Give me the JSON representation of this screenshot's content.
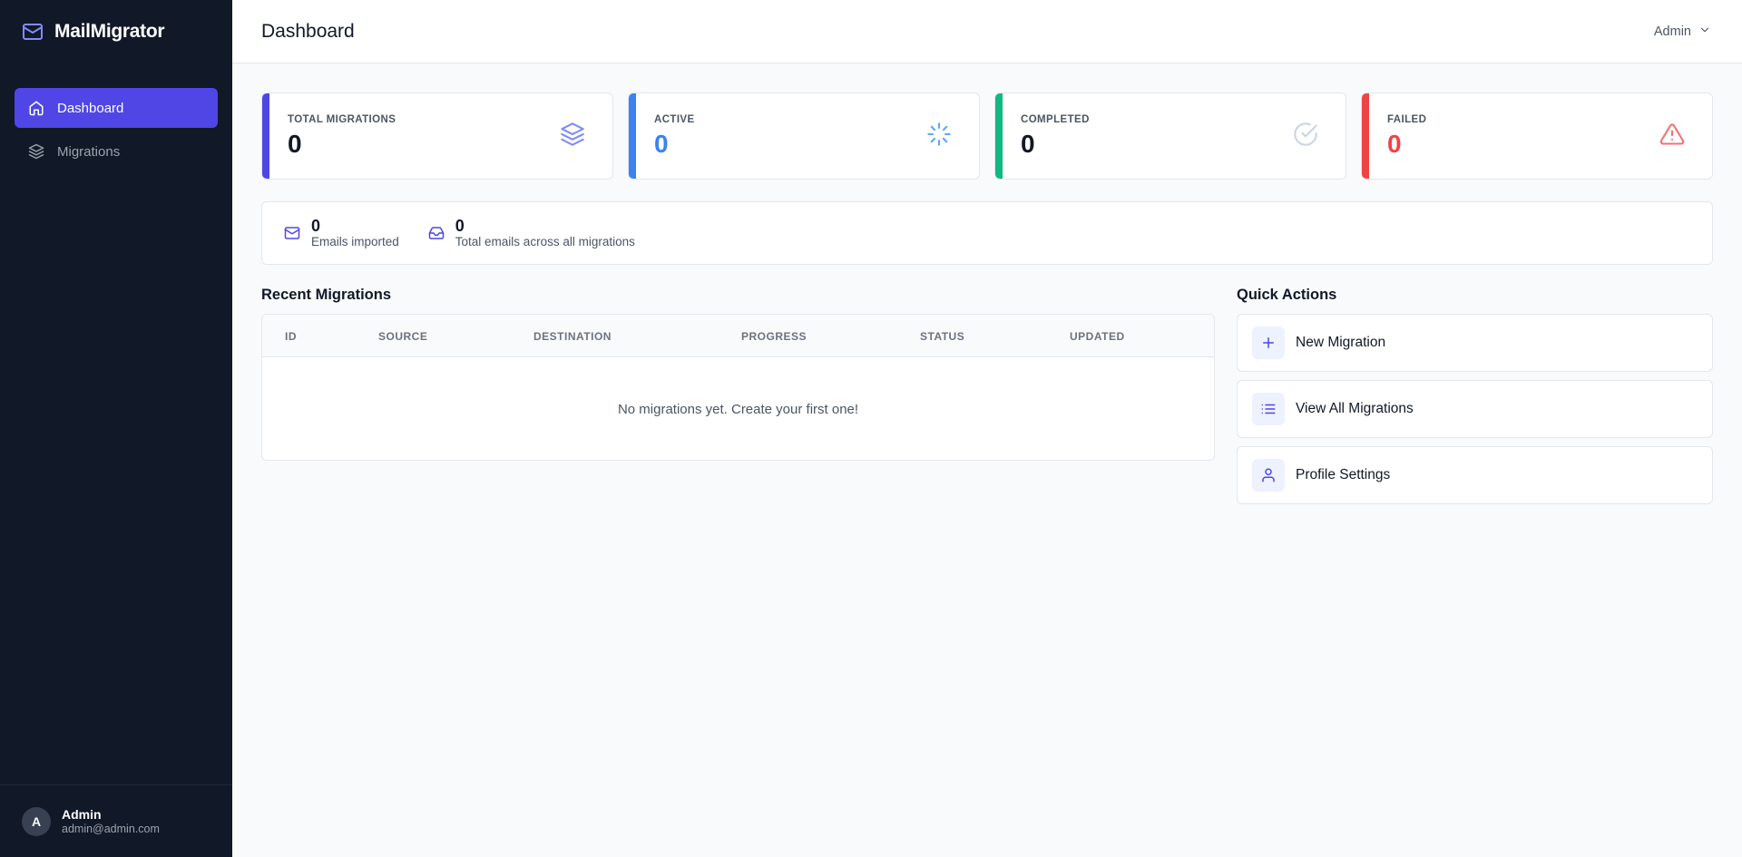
{
  "app": {
    "name": "MailMigrator"
  },
  "sidebar": {
    "items": [
      {
        "label": "Dashboard",
        "icon": "home-icon",
        "active": true
      },
      {
        "label": "Migrations",
        "icon": "layers-icon",
        "active": false
      }
    ],
    "user": {
      "initial": "A",
      "name": "Admin",
      "email": "admin@admin.com"
    }
  },
  "header": {
    "title": "Dashboard",
    "user_label": "Admin"
  },
  "stats": [
    {
      "label": "TOTAL MIGRATIONS",
      "value": "0",
      "accent": "#4f46e5",
      "value_color": "#111827",
      "icon": "layers-icon"
    },
    {
      "label": "ACTIVE",
      "value": "0",
      "accent": "#3b82f6",
      "value_color": "#3b82f6",
      "icon": "loader-icon"
    },
    {
      "label": "COMPLETED",
      "value": "0",
      "accent": "#10b981",
      "value_color": "#111827",
      "icon": "check-circle-icon"
    },
    {
      "label": "FAILED",
      "value": "0",
      "accent": "#ef4444",
      "value_color": "#ef4444",
      "icon": "alert-triangle-icon"
    }
  ],
  "emails": [
    {
      "value": "0",
      "label": "Emails imported",
      "icon": "mail-icon"
    },
    {
      "value": "0",
      "label": "Total emails across all migrations",
      "icon": "inbox-icon"
    }
  ],
  "recent": {
    "title": "Recent Migrations",
    "columns": [
      "ID",
      "SOURCE",
      "DESTINATION",
      "PROGRESS",
      "STATUS",
      "UPDATED"
    ],
    "empty_message": "No migrations yet. Create your first one!"
  },
  "quick_actions": {
    "title": "Quick Actions",
    "items": [
      {
        "label": "New Migration",
        "icon": "plus-icon"
      },
      {
        "label": "View All Migrations",
        "icon": "list-icon"
      },
      {
        "label": "Profile Settings",
        "icon": "user-icon"
      }
    ]
  }
}
